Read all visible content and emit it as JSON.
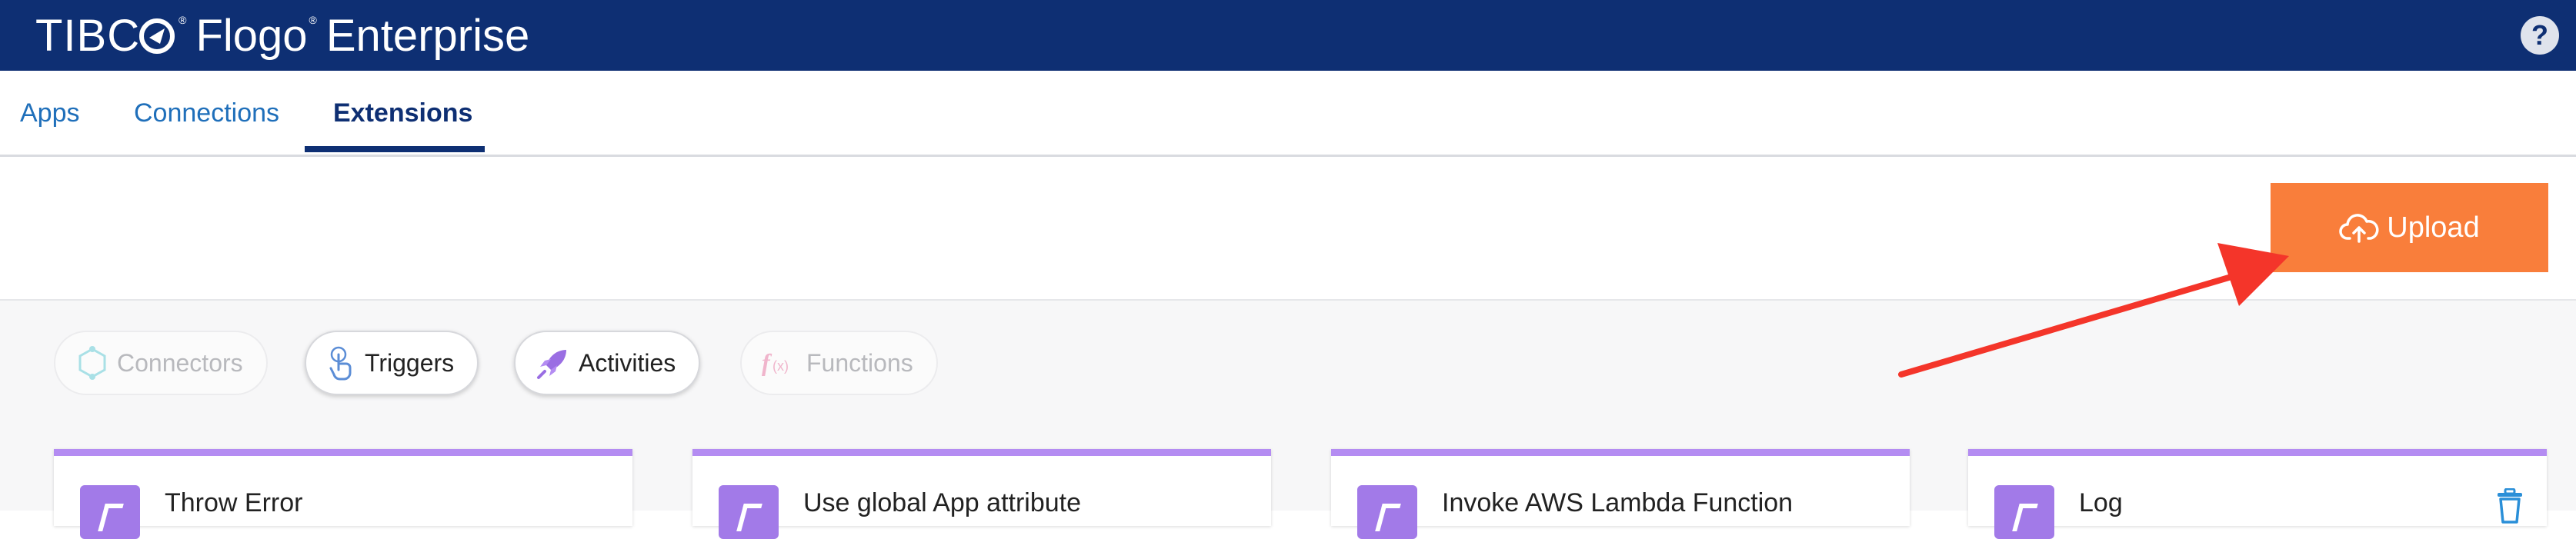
{
  "header": {
    "brand_company": "TIBC",
    "brand_registered": "®",
    "brand_product": "Flogo",
    "brand_product_registered": "®",
    "brand_edition": " Enterprise",
    "help_label": "?"
  },
  "tabs": [
    {
      "label": "Apps",
      "active": false
    },
    {
      "label": "Connections",
      "active": false
    },
    {
      "label": "Extensions",
      "active": true
    }
  ],
  "toolbar": {
    "upload_label": "Upload",
    "upload_icon": "cloud-upload-icon"
  },
  "filters": [
    {
      "label": "Connectors",
      "icon": "connectors-icon",
      "state": "disabled"
    },
    {
      "label": "Triggers",
      "icon": "pointer-hand-icon",
      "state": "active"
    },
    {
      "label": "Activities",
      "icon": "rocket-icon",
      "state": "active"
    },
    {
      "label": "Functions",
      "icon": "function-icon",
      "state": "disabled"
    }
  ],
  "cards": [
    {
      "title": "Throw Error",
      "icon": "activity-icon"
    },
    {
      "title": "Use global App attribute",
      "icon": "activity-icon"
    },
    {
      "title": "Invoke AWS Lambda Function",
      "icon": "activity-icon"
    },
    {
      "title": "Log",
      "icon": "activity-icon",
      "action_icon": "trash-icon"
    }
  ],
  "colors": {
    "header_bg": "#0e2f73",
    "tab_link": "#1f6fba",
    "upload_bg": "#f97e3b",
    "card_accent": "#b48cf2",
    "annotation_arrow": "#f4352a"
  }
}
